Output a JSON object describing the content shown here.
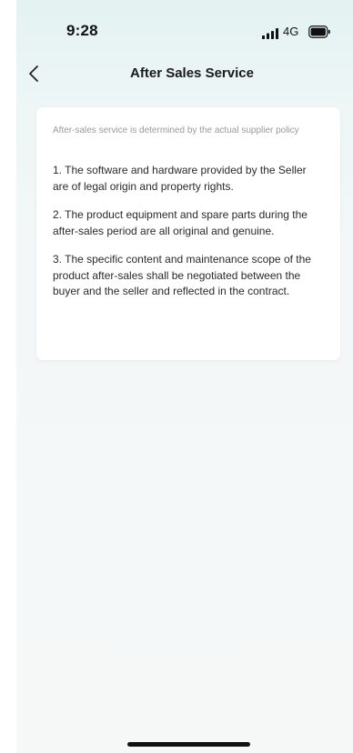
{
  "status_bar": {
    "time": "9:28",
    "network": "4G",
    "signal_icon": "signal-bars-icon",
    "battery_icon": "battery-icon"
  },
  "nav": {
    "back_icon": "chevron-left-icon",
    "title": "After Sales Service"
  },
  "card": {
    "notice": "After-sales service is determined by the actual supplier policy",
    "terms": [
      "1. The software and hardware provided by the Seller are of legal origin and property rights.",
      "2. The product equipment and spare parts during the after-sales period are all original and genuine.",
      "3. The specific content and maintenance scope of the product after-sales shall be negotiated between the buyer and the seller and reflected in the contract."
    ]
  },
  "colors": {
    "header_tint": "#e4f2f2",
    "card_background": "#ffffff",
    "notice_text": "#9a9a9a",
    "body_text": "#2a2a2a"
  }
}
